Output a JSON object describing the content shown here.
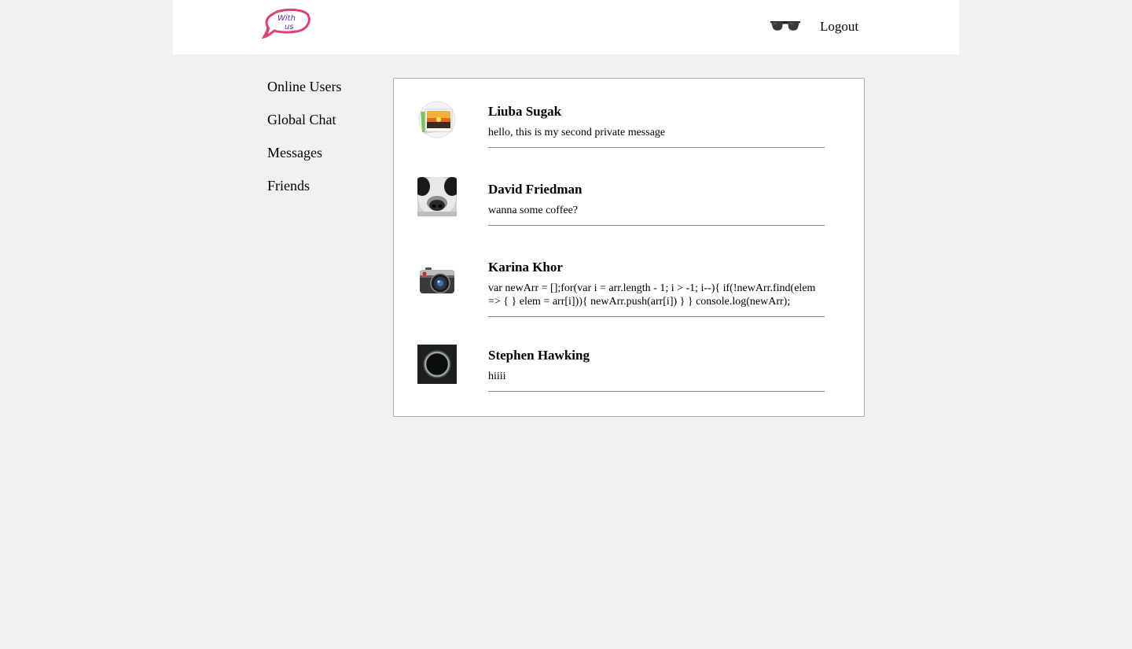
{
  "header": {
    "logo_text": "With us",
    "glasses_icon": "sunglasses-icon",
    "logout_label": "Logout"
  },
  "sidebar": {
    "items": [
      {
        "label": "Online Users"
      },
      {
        "label": "Global Chat"
      },
      {
        "label": "Messages"
      },
      {
        "label": "Friends"
      }
    ]
  },
  "messages": [
    {
      "name": "Liuba Sugak",
      "text": "hello, this is my second private message",
      "avatar": "photo-stack-icon"
    },
    {
      "name": "David Friedman",
      "text": "wanna some coffee?",
      "avatar": "panda-photo"
    },
    {
      "name": "Karina Khor",
      "text": "var newArr = [];for(var i = arr.length - 1; i > -1; i--){ if(!newArr.find(elem => { } elem = arr[i])){ newArr.push(arr[i]) } } console.log(newArr);",
      "avatar": "camera-icon"
    },
    {
      "name": "Stephen Hawking",
      "text": "hiiii",
      "avatar": "eclipse-ring-photo"
    }
  ],
  "colors": {
    "background": "#f1f1f1",
    "panel": "#ffffff",
    "border": "#a9a9a9",
    "logo_pink": "#e0407a",
    "logo_purple": "#5b2a9e"
  }
}
